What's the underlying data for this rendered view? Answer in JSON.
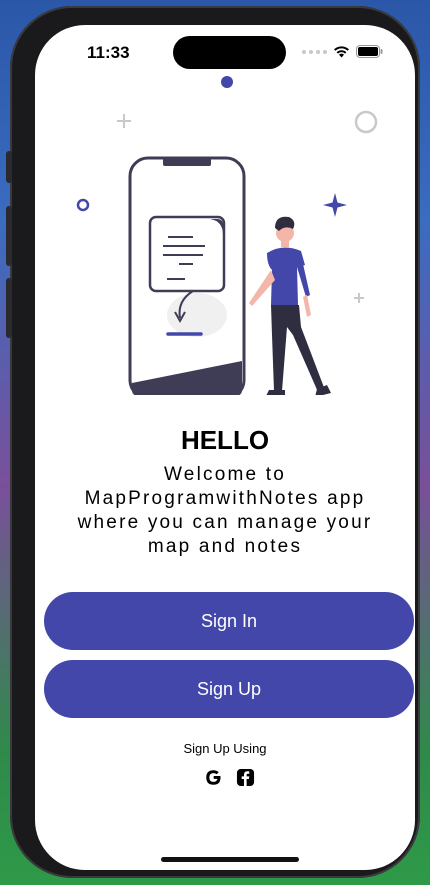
{
  "status_bar": {
    "time": "11:33"
  },
  "screen": {
    "title": "HELLO",
    "welcome_text": "Welcome to\nMapProgramwithNotes app\nwhere you can manage your\nmap and notes"
  },
  "buttons": {
    "sign_in_label": "Sign In",
    "sign_up_label": "Sign Up"
  },
  "social": {
    "caption": "Sign Up Using",
    "providers": [
      {
        "name": "google",
        "icon": "google-icon"
      },
      {
        "name": "facebook",
        "icon": "facebook-icon"
      }
    ]
  },
  "colors": {
    "accent": "#4347a9",
    "illustration_accent": "#4347a9",
    "illustration_dark": "#3f3d56"
  }
}
